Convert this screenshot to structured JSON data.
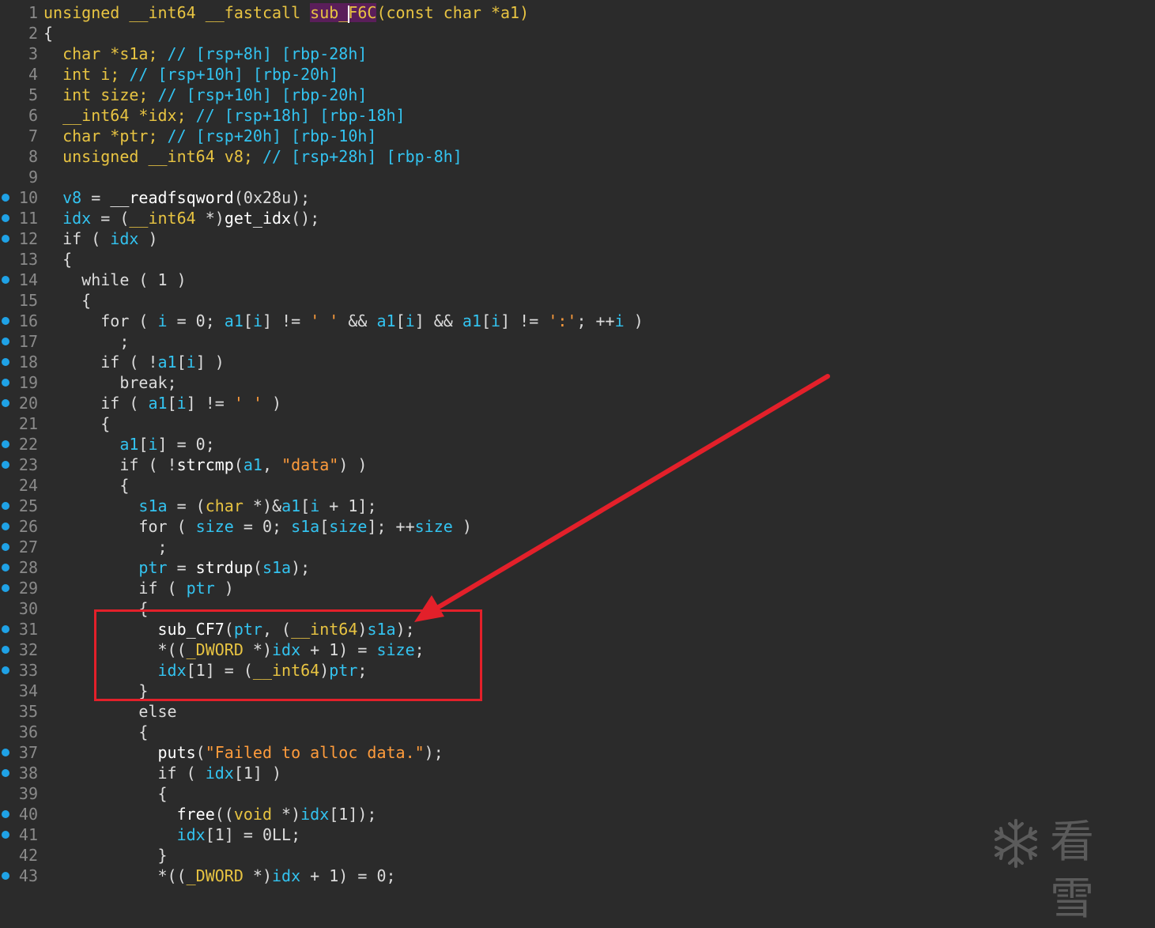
{
  "code_lines": [
    {
      "n": "1",
      "bp": false,
      "html": "<span class=\"ty\">unsigned __int64 __fastcall </span><span class=\"hl\">sub_<span class=\"cursor\"></span>F6C</span><span class=\"ty\">(const char *a1)</span>"
    },
    {
      "n": "2",
      "bp": false,
      "html": "{"
    },
    {
      "n": "3",
      "bp": false,
      "html": "  <span class=\"ty\">char *s1a; </span><span class=\"cm\">// [rsp+8h] [rbp-28h]</span>"
    },
    {
      "n": "4",
      "bp": false,
      "html": "  <span class=\"ty\">int i; </span><span class=\"cm\">// [rsp+10h] [rbp-20h]</span>"
    },
    {
      "n": "5",
      "bp": false,
      "html": "  <span class=\"ty\">int size; </span><span class=\"cm\">// [rsp+10h] [rbp-20h]</span>"
    },
    {
      "n": "6",
      "bp": false,
      "html": "  <span class=\"ty\">__int64 *idx; </span><span class=\"cm\">// [rsp+18h] [rbp-18h]</span>"
    },
    {
      "n": "7",
      "bp": false,
      "html": "  <span class=\"ty\">char *ptr; </span><span class=\"cm\">// [rsp+20h] [rbp-10h]</span>"
    },
    {
      "n": "8",
      "bp": false,
      "html": "  <span class=\"ty\">unsigned __int64 v8; </span><span class=\"cm\">// [rsp+28h] [rbp-8h]</span>"
    },
    {
      "n": "9",
      "bp": false,
      "html": ""
    },
    {
      "n": "10",
      "bp": true,
      "html": "  <span class=\"var\">v8</span> = <span class=\"fn\">__readfsqword</span>(0x28u);"
    },
    {
      "n": "11",
      "bp": true,
      "html": "  <span class=\"var\">idx</span> = (<span class=\"ty\">__int64</span> *)<span class=\"fn\">get_idx</span>();"
    },
    {
      "n": "12",
      "bp": true,
      "html": "  if ( <span class=\"var\">idx</span> )"
    },
    {
      "n": "13",
      "bp": false,
      "html": "  {"
    },
    {
      "n": "14",
      "bp": true,
      "html": "    while ( 1 )"
    },
    {
      "n": "15",
      "bp": false,
      "html": "    {"
    },
    {
      "n": "16",
      "bp": true,
      "html": "      for ( <span class=\"var\">i</span> = 0; <span class=\"var\">a1</span>[<span class=\"var\">i</span>] != <span class=\"str\">' '</span> &amp;&amp; <span class=\"var\">a1</span>[<span class=\"var\">i</span>] &amp;&amp; <span class=\"var\">a1</span>[<span class=\"var\">i</span>] != <span class=\"str\">':'</span>; ++<span class=\"var\">i</span> )"
    },
    {
      "n": "17",
      "bp": true,
      "html": "        ;"
    },
    {
      "n": "18",
      "bp": true,
      "html": "      if ( !<span class=\"var\">a1</span>[<span class=\"var\">i</span>] )"
    },
    {
      "n": "19",
      "bp": true,
      "html": "        break;"
    },
    {
      "n": "20",
      "bp": true,
      "html": "      if ( <span class=\"var\">a1</span>[<span class=\"var\">i</span>] != <span class=\"str\">' '</span> )"
    },
    {
      "n": "21",
      "bp": false,
      "html": "      {"
    },
    {
      "n": "22",
      "bp": true,
      "html": "        <span class=\"var\">a1</span>[<span class=\"var\">i</span>] = 0;"
    },
    {
      "n": "23",
      "bp": true,
      "html": "        if ( !<span class=\"fn\">strcmp</span>(<span class=\"var\">a1</span>, <span class=\"str\">\"data\"</span>) )"
    },
    {
      "n": "24",
      "bp": false,
      "html": "        {"
    },
    {
      "n": "25",
      "bp": true,
      "html": "          <span class=\"var\">s1a</span> = (<span class=\"ty\">char</span> *)&amp;<span class=\"var\">a1</span>[<span class=\"var\">i</span> + 1];"
    },
    {
      "n": "26",
      "bp": true,
      "html": "          for ( <span class=\"var\">size</span> = 0; <span class=\"var\">s1a</span>[<span class=\"var\">size</span>]; ++<span class=\"var\">size</span> )"
    },
    {
      "n": "27",
      "bp": true,
      "html": "            ;"
    },
    {
      "n": "28",
      "bp": true,
      "html": "          <span class=\"var\">ptr</span> = <span class=\"fn\">strdup</span>(<span class=\"var\">s1a</span>);"
    },
    {
      "n": "29",
      "bp": true,
      "html": "          if ( <span class=\"var\">ptr</span> )"
    },
    {
      "n": "30",
      "bp": false,
      "html": "          {"
    },
    {
      "n": "31",
      "bp": true,
      "html": "            <span class=\"fn\">sub_CF7</span>(<span class=\"var\">ptr</span>, (<span class=\"ty\">__int64</span>)<span class=\"var\">s1a</span>);"
    },
    {
      "n": "32",
      "bp": true,
      "html": "            *((<span class=\"ty\">_DWORD</span> *)<span class=\"var\">idx</span> + 1) = <span class=\"var\">size</span>;"
    },
    {
      "n": "33",
      "bp": true,
      "html": "            <span class=\"var\">idx</span>[1] = (<span class=\"ty\">__int64</span>)<span class=\"var\">ptr</span>;"
    },
    {
      "n": "34",
      "bp": false,
      "html": "          }"
    },
    {
      "n": "35",
      "bp": false,
      "html": "          else"
    },
    {
      "n": "36",
      "bp": false,
      "html": "          {"
    },
    {
      "n": "37",
      "bp": true,
      "html": "            <span class=\"fn\">puts</span>(<span class=\"str\">\"Failed to alloc data.\"</span>);"
    },
    {
      "n": "38",
      "bp": true,
      "html": "            if ( <span class=\"var\">idx</span>[1] )"
    },
    {
      "n": "39",
      "bp": false,
      "html": "            {"
    },
    {
      "n": "40",
      "bp": true,
      "html": "              <span class=\"fn\">free</span>((<span class=\"ty\">void</span> *)<span class=\"var\">idx</span>[1]);"
    },
    {
      "n": "41",
      "bp": true,
      "html": "              <span class=\"var\">idx</span>[1] = 0LL;"
    },
    {
      "n": "42",
      "bp": false,
      "html": "            }"
    },
    {
      "n": "43",
      "bp": true,
      "html": "            *((<span class=\"ty\">_DWORD</span> *)<span class=\"var\">idx</span> + 1) = 0;"
    }
  ],
  "watermark": {
    "text": "看雪",
    "icon": "snowflake-icon"
  },
  "colors": {
    "background": "#2b2b2b",
    "breakpoint": "#1fa2e6",
    "annotation": "#e3202a",
    "type": "#e8c442",
    "variable": "#33c3f0",
    "string": "#ff9c3c"
  }
}
